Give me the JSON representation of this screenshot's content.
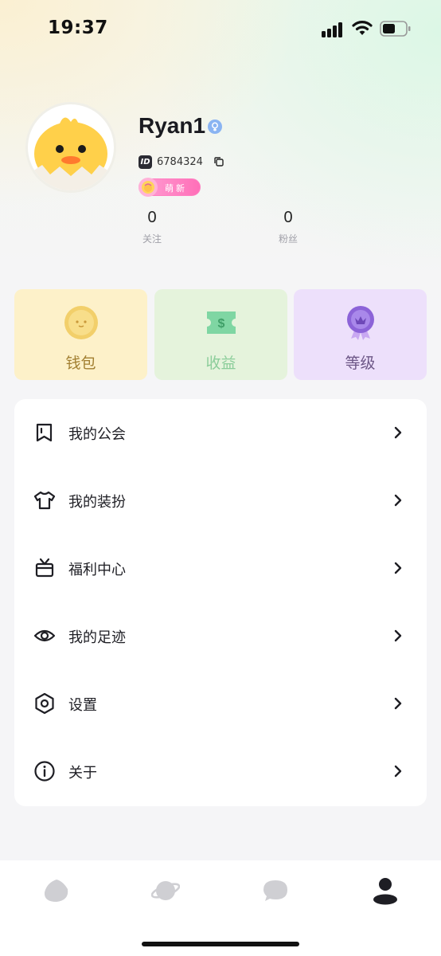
{
  "status_bar": {
    "time": "19:37"
  },
  "profile": {
    "username": "Ryan1",
    "id_tag": "ID",
    "id_value": "6784324",
    "badge_text": "萌新",
    "stats": [
      {
        "value": "0",
        "label": "关注"
      },
      {
        "value": "0",
        "label": "粉丝"
      }
    ]
  },
  "cards": [
    {
      "label": "钱包",
      "icon": "coin-icon"
    },
    {
      "label": "收益",
      "icon": "ticket-icon"
    },
    {
      "label": "等级",
      "icon": "medal-icon"
    }
  ],
  "menu": {
    "items": [
      {
        "label": "我的公会",
        "icon": "bookmark-icon"
      },
      {
        "label": "我的装扮",
        "icon": "shirt-icon"
      },
      {
        "label": "福利中心",
        "icon": "gift-icon"
      },
      {
        "label": "我的足迹",
        "icon": "eye-icon"
      },
      {
        "label": "设置",
        "icon": "hexagon-settings-icon"
      },
      {
        "label": "关于",
        "icon": "info-icon"
      }
    ]
  },
  "tabbar": {
    "tabs": [
      {
        "icon": "home-blob-icon",
        "active": false
      },
      {
        "icon": "planet-icon",
        "active": false
      },
      {
        "icon": "chat-bubble-icon",
        "active": false
      },
      {
        "icon": "profile-icon",
        "active": true
      }
    ]
  },
  "colors": {
    "wallet_bg": "#fdf1c9",
    "income_bg": "#e5f3dc",
    "level_bg": "#ede0fb",
    "badge_pink": "#ff6fb8"
  }
}
